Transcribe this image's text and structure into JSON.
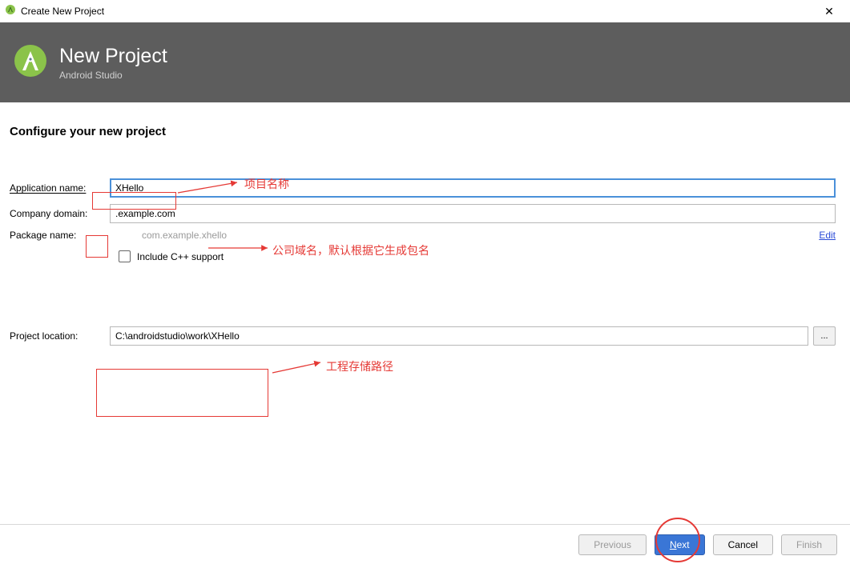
{
  "window": {
    "title": "Create New Project"
  },
  "header": {
    "title": "New Project",
    "subtitle": "Android Studio"
  },
  "section_title": "Configure your new project",
  "labels": {
    "application_name": "Application name:",
    "company_domain": "Company domain:",
    "package_name": "Package name:",
    "project_location": "Project location:"
  },
  "values": {
    "application_name": "XHello",
    "company_domain": ".example.com",
    "package_name": "com.example.xhello",
    "project_location": "C:\\androidstudio\\work\\XHello"
  },
  "checkbox": {
    "include_cpp": "Include C++ support"
  },
  "links": {
    "edit": "Edit"
  },
  "buttons": {
    "browse": "...",
    "previous": "Previous",
    "next": "Next",
    "cancel": "Cancel",
    "finish": "Finish"
  },
  "annotations": {
    "project_name": "项目名称",
    "company_domain": "公司域名，默认根据它生成包名",
    "project_location": "工程存储路径"
  }
}
